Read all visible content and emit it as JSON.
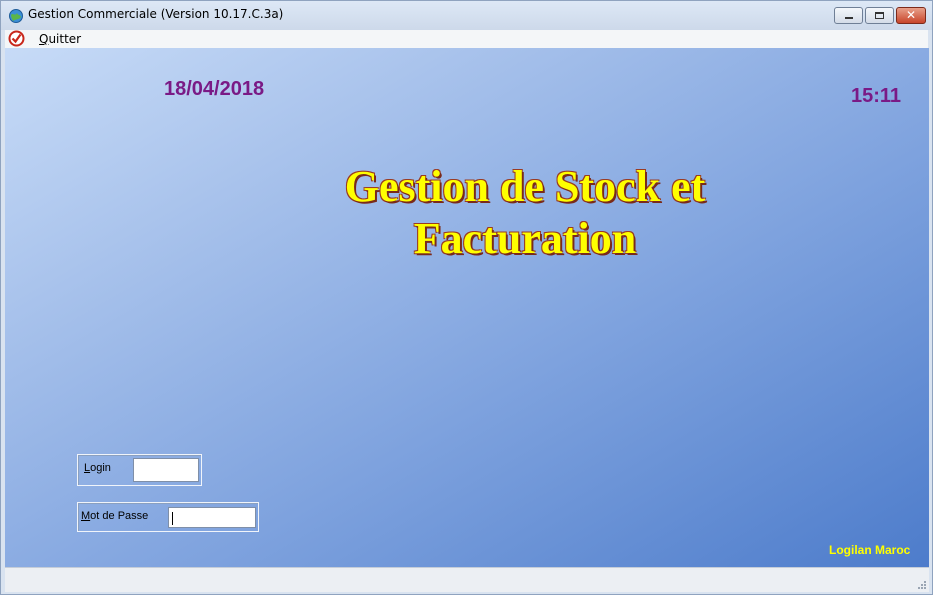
{
  "window": {
    "title": "Gestion Commerciale (Version 10.17.C.3a)",
    "icons": [
      "app-globe-icon",
      "minimize-icon",
      "maximize-icon",
      "close-icon"
    ]
  },
  "menu": {
    "items": [
      {
        "label_underlined": "Q",
        "label_rest": "uitter",
        "icon": "checkmark-circle-icon"
      }
    ]
  },
  "main": {
    "date": "18/04/2018",
    "time": "15:11",
    "headline_line1": "Gestion de Stock et",
    "headline_line2": "Facturation",
    "brand": "Logilan Maroc"
  },
  "form": {
    "login_label_underlined": "L",
    "login_label_rest": "ogin",
    "login_value": "",
    "password_label_underlined": "M",
    "password_label_rest": "ot de Passe",
    "password_value": ""
  },
  "colors": {
    "date_color": "#7a1a86",
    "headline_color": "#ffff00",
    "brand_color": "#ffff00",
    "background_gradient": [
      "#c7dbf7",
      "#4d7ccb"
    ]
  }
}
